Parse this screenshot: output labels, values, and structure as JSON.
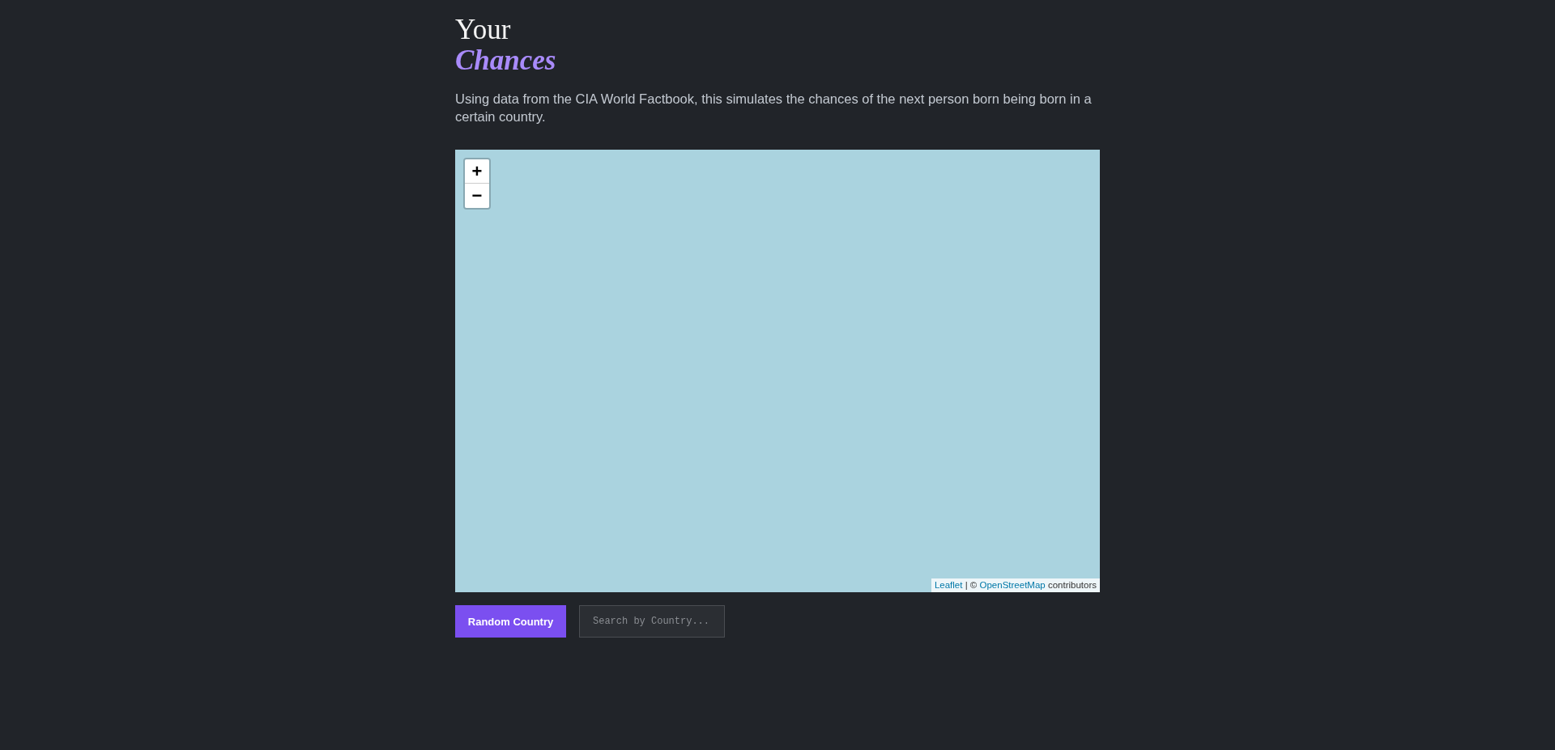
{
  "heading": {
    "title": "Your",
    "highlight": "Chances"
  },
  "description": "Using data from the CIA World Factbook, this simulates the chances of the next person born being born in a certain country.",
  "map": {
    "zoom_buttons": [
      "+",
      "−"
    ],
    "attribution": [
      {
        "kind": "link",
        "text": "Leaflet"
      },
      {
        "kind": "text",
        "text": "| ©"
      },
      {
        "kind": "link",
        "text": "OpenStreetMap"
      },
      {
        "kind": "text",
        "text": "contributors"
      }
    ]
  },
  "controls": {
    "random_button": "Random Country",
    "search": {
      "placeholder": "Search by Country..."
    }
  }
}
